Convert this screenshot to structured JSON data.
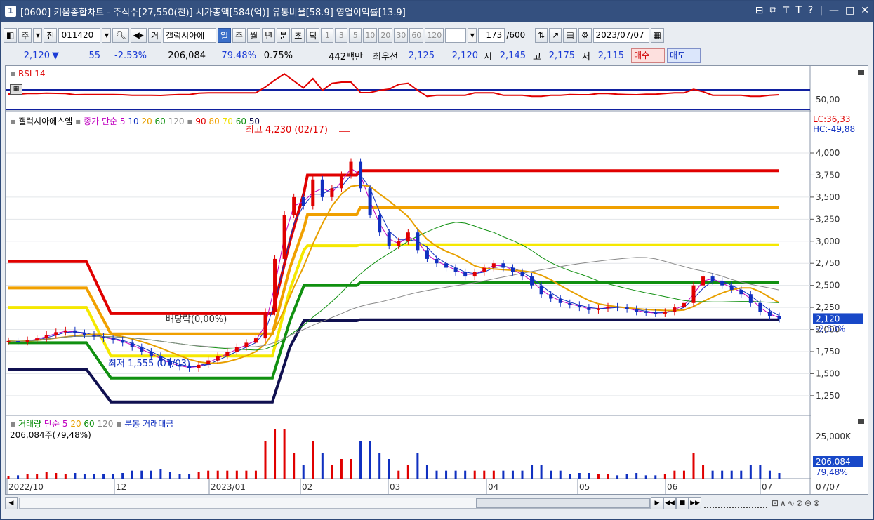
{
  "window": {
    "id": "1",
    "title": "[0600] 키움종합차트 - 주식수[27,550(천)] 시가총액[584(억)] 유통비율[58.9] 영업이익률[13.9]",
    "controls": [
      "⊟",
      "⧉",
      "₸",
      "T",
      "?",
      "|",
      "—",
      "□",
      "✕"
    ]
  },
  "toolbar": {
    "type_label": "주",
    "prev_label": "전",
    "code": "011420",
    "name_label": "거",
    "name": "갤럭시아에",
    "periods": [
      "일",
      "주",
      "월",
      "년",
      "분",
      "초",
      "틱"
    ],
    "active_period": "일",
    "nums": [
      "1",
      "3",
      "5",
      "10",
      "20",
      "30",
      "60",
      "120"
    ],
    "count": "173",
    "count_max": "/600",
    "date": "2023/07/07"
  },
  "quote": {
    "price": "2,120",
    "arrow": "▼",
    "change": "55",
    "pct": "-2.53%",
    "volume": "206,084",
    "vol_pct": "79.48%",
    "turnover": "0.75%",
    "amount": "442백만",
    "best_label": "최우선",
    "ask": "2,125",
    "bid": "2,120",
    "open_label": "시",
    "open": "2,145",
    "high_label": "고",
    "high": "2,175",
    "low_label": "저",
    "low": "2,115",
    "buy_label": "매수",
    "sell_label": "매도"
  },
  "rsi": {
    "label": "RSI 14",
    "level": "50,00"
  },
  "price_panel": {
    "name": "갤럭시아에스엠",
    "ma_label": "종가 단순",
    "ma": [
      "5",
      "10",
      "20",
      "60",
      "120"
    ],
    "env": [
      "90",
      "80",
      "70",
      "60",
      "50"
    ],
    "lc": "LC:36,33",
    "hc": "HC:-49,88",
    "high_note": "최고 4,230 (02/17)",
    "low_note": "최저 1,555 (01/03)",
    "div_note": "배당락(0,00%)",
    "cur_price": "2,120",
    "cur_pct": "-2,53%"
  },
  "volume_panel": {
    "label": "거래량",
    "ma_label": "단순",
    "ma": [
      "5",
      "20",
      "60",
      "120"
    ],
    "extra": "분봉 거래대금",
    "value_label": "206,084주(79,48%)",
    "axis": "25,000K",
    "cur": "206,084",
    "cur_pct": "79,48%"
  },
  "x_axis": {
    "labels": [
      "2022/10",
      "12",
      "2023/01",
      "02",
      "03",
      "04",
      "05",
      "06",
      "07"
    ],
    "cur": "07/07"
  },
  "colors": {
    "up": "#e00000",
    "down": "#1030c0",
    "titlebar": "#34507f"
  },
  "chart_data": {
    "type": "candlestick",
    "y_ticks": [
      1250,
      1500,
      1750,
      2000,
      2250,
      2500,
      2750,
      3000,
      3250,
      3500,
      3750,
      4000
    ],
    "ylim": [
      1050,
      4350
    ],
    "period_high": {
      "value": 4230,
      "date": "02/17"
    },
    "period_low": {
      "value": 1555,
      "date": "01/03"
    },
    "last": {
      "open": 2145,
      "high": 2175,
      "low": 2115,
      "close": 2120
    },
    "close_series": [
      1870,
      1860,
      1880,
      1900,
      1940,
      1970,
      1990,
      1960,
      1940,
      1920,
      1900,
      1880,
      1850,
      1800,
      1750,
      1700,
      1640,
      1600,
      1580,
      1560,
      1600,
      1650,
      1700,
      1750,
      1800,
      1850,
      1900,
      2200,
      2800,
      3300,
      3500,
      3400,
      3700,
      3500,
      3600,
      3750,
      3900,
      3600,
      3300,
      3100,
      2950,
      3000,
      3100,
      2900,
      2800,
      2750,
      2700,
      2650,
      2600,
      2650,
      2700,
      2750,
      2700,
      2650,
      2600,
      2500,
      2400,
      2350,
      2300,
      2280,
      2250,
      2220,
      2240,
      2260,
      2250,
      2230,
      2200,
      2190,
      2180,
      2200,
      2250,
      2300,
      2500,
      2600,
      2550,
      2500,
      2450,
      2400,
      2300,
      2200,
      2150,
      2120
    ],
    "rsi_level": 50,
    "volume_axis": "25,000K"
  }
}
